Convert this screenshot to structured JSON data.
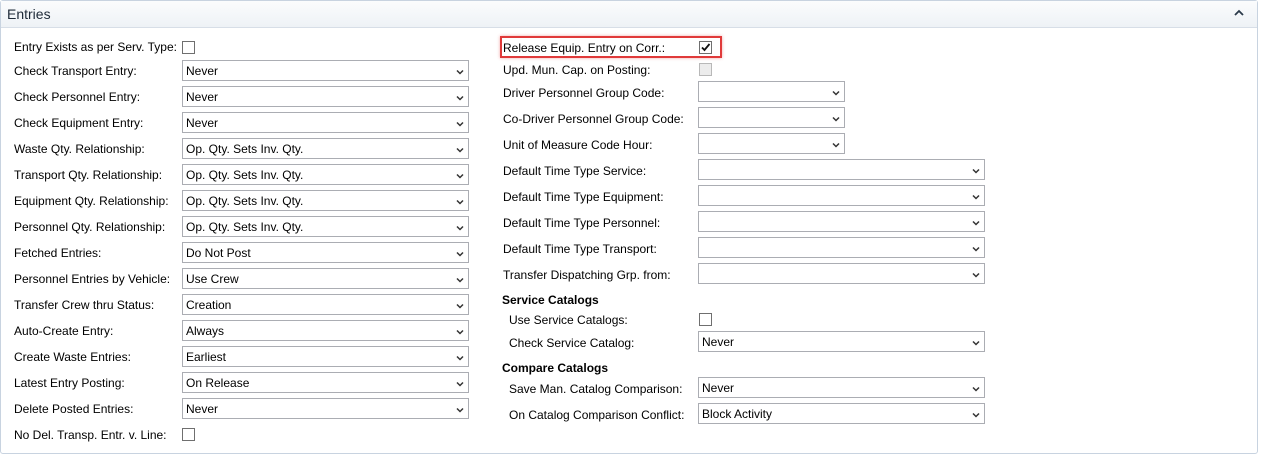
{
  "panel": {
    "title": "Entries",
    "collapse_icon": "chevron-up-icon"
  },
  "left": {
    "entry_exists": {
      "label": "Entry Exists as per Serv. Type:",
      "checked": false
    },
    "check_transport": {
      "label": "Check Transport Entry:",
      "value": "Never"
    },
    "check_personnel": {
      "label": "Check Personnel Entry:",
      "value": "Never"
    },
    "check_equipment": {
      "label": "Check Equipment Entry:",
      "value": "Never"
    },
    "waste_qty": {
      "label": "Waste Qty. Relationship:",
      "value": "Op. Qty. Sets Inv. Qty."
    },
    "transport_qty": {
      "label": "Transport Qty. Relationship:",
      "value": "Op. Qty. Sets Inv. Qty."
    },
    "equipment_qty": {
      "label": "Equipment Qty. Relationship:",
      "value": "Op. Qty. Sets Inv. Qty."
    },
    "personnel_qty": {
      "label": "Personnel Qty. Relationship:",
      "value": "Op. Qty. Sets Inv. Qty."
    },
    "fetched_entries": {
      "label": "Fetched Entries:",
      "value": "Do Not Post"
    },
    "personnel_by_vehicle": {
      "label": "Personnel Entries by Vehicle:",
      "value": "Use Crew"
    },
    "transfer_crew": {
      "label": "Transfer Crew thru Status:",
      "value": "Creation"
    },
    "auto_create": {
      "label": "Auto-Create Entry:",
      "value": "Always"
    },
    "create_waste": {
      "label": "Create Waste Entries:",
      "value": "Earliest"
    },
    "latest_posting": {
      "label": "Latest Entry Posting:",
      "value": "On Release"
    },
    "delete_posted": {
      "label": "Delete Posted Entries:",
      "value": "Never"
    },
    "no_del_transp": {
      "label": "No Del. Transp. Entr. v. Line:",
      "checked": false
    }
  },
  "right": {
    "release_equip": {
      "label": "Release Equip. Entry on Corr.:",
      "checked": true
    },
    "upd_mun_cap": {
      "label": "Upd. Mun. Cap. on Posting:",
      "checked": false,
      "disabled": true
    },
    "driver_group": {
      "label": "Driver Personnel Group Code:",
      "value": ""
    },
    "codriver_group": {
      "label": "Co-Driver Personnel Group Code:",
      "value": ""
    },
    "uom_hour": {
      "label": "Unit of Measure Code Hour:",
      "value": ""
    },
    "time_service": {
      "label": "Default Time Type Service:",
      "value": ""
    },
    "time_equipment": {
      "label": "Default Time Type Equipment:",
      "value": ""
    },
    "time_personnel": {
      "label": "Default Time Type Personnel:",
      "value": ""
    },
    "time_transport": {
      "label": "Default Time Type Transport:",
      "value": ""
    },
    "transfer_dispatch": {
      "label": "Transfer Dispatching Grp. from:",
      "value": ""
    },
    "service_catalogs": {
      "title": "Service Catalogs",
      "use": {
        "label": "Use Service Catalogs:",
        "checked": false
      },
      "check": {
        "label": "Check Service Catalog:",
        "value": "Never"
      }
    },
    "compare_catalogs": {
      "title": "Compare Catalogs",
      "save_man": {
        "label": "Save Man. Catalog Comparison:",
        "value": "Never"
      },
      "conflict": {
        "label": "On Catalog Comparison Conflict:",
        "value": "Block Activity"
      }
    }
  },
  "colors": {
    "highlight": "#e03a3a",
    "border": "#abadb3",
    "header_bg": "#eef2f6"
  }
}
